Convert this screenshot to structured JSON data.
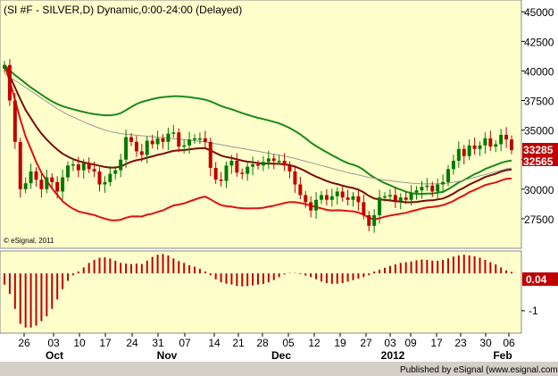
{
  "chart_data": [
    {
      "type": "candlestick",
      "title": "(SI #F - SILVER,D) Dynamic,0:00-24:00 (Delayed)",
      "watermark": "© eSignal, 2011",
      "ylim": [
        25000,
        46000
      ],
      "y_ticks": [
        "45000",
        "42500",
        "40000",
        "37500",
        "35000",
        "32500",
        "30000",
        "27500"
      ],
      "last_price_label": "33285",
      "second_price_label": "32565",
      "up_color": "#007a00",
      "down_color": "#c00000",
      "x_day_labels": [
        "26",
        "03",
        "10",
        "17",
        "24",
        "31",
        "07",
        "14",
        "21",
        "28",
        "05",
        "12",
        "19",
        "27",
        "03",
        "09",
        "17",
        "23",
        "30",
        "06"
      ],
      "x_month_labels": [
        "Oct",
        "Nov",
        "Dec",
        "2012",
        "Feb"
      ],
      "close": [
        40500,
        37500,
        34000,
        30000,
        30500,
        31500,
        30800,
        30000,
        31000,
        30600,
        29800,
        31000,
        32000,
        32100,
        31600,
        32200,
        31700,
        31500,
        30400,
        30600,
        31300,
        31600,
        32500,
        34400,
        34000,
        33200,
        32900,
        34100,
        33800,
        34300,
        34000,
        34700,
        34800,
        33600,
        33700,
        34200,
        34300,
        34300,
        34000,
        31800,
        30800,
        30700,
        32000,
        32400,
        31400,
        31300,
        31900,
        32100,
        32000,
        32300,
        32600,
        32400,
        32400,
        32000,
        31500,
        30400,
        29500,
        28900,
        28200,
        29100,
        29500,
        29100,
        29400,
        29800,
        29300,
        29100,
        29400,
        28900,
        27800,
        26900,
        27800,
        29300,
        29400,
        29500,
        29000,
        29300,
        29100,
        29700,
        29900,
        30200,
        30300,
        29800,
        30400,
        30600,
        31700,
        32400,
        33400,
        32800,
        33700,
        33400,
        33700,
        34300,
        33600,
        33800,
        34600,
        34200,
        33300
      ],
      "overlays": [
        {
          "color": "#1a8a1a",
          "values": [
            40500,
            40050,
            39650,
            39300,
            38950,
            38600,
            38300,
            38000,
            37700,
            37430,
            37200,
            37020,
            36880,
            36760,
            36640,
            36530,
            36430,
            36350,
            36290,
            36250,
            36250,
            36300,
            36430,
            36680,
            36950,
            37200,
            37380,
            37500,
            37620,
            37720,
            37780,
            37820,
            37860,
            37860,
            37830,
            37780,
            37720,
            37650,
            37570,
            37420,
            37230,
            37030,
            36880,
            36760,
            36600,
            36430,
            36290,
            36160,
            36030,
            35930,
            35820,
            35700,
            35560,
            35380,
            35170,
            34920,
            34630,
            34300,
            33940,
            33640,
            33380,
            33130,
            32880,
            32640,
            32400,
            32200,
            32070,
            31900,
            31630,
            31270,
            30980,
            30740,
            30510,
            30330,
            30120,
            29960,
            29780,
            29670,
            29600,
            29600,
            29630,
            29630,
            29700,
            29770,
            29990,
            30270,
            30560,
            30780,
            31030,
            31270,
            31460,
            31710,
            31880,
            32050,
            32230,
            32350,
            32420
          ]
        },
        {
          "color": "#7a0a0a",
          "values": [
            40500,
            39600,
            38600,
            37600,
            36700,
            36000,
            35300,
            34700,
            34200,
            33750,
            33350,
            33000,
            32750,
            32550,
            32380,
            32270,
            32170,
            32080,
            31970,
            31880,
            31820,
            31830,
            31920,
            32130,
            32320,
            32450,
            32530,
            32670,
            32770,
            32900,
            32990,
            33120,
            33240,
            33280,
            33310,
            33370,
            33420,
            33460,
            33470,
            33280,
            33050,
            32840,
            32720,
            32640,
            32520,
            32410,
            32330,
            32270,
            32210,
            32180,
            32170,
            32150,
            32140,
            32100,
            32040,
            31910,
            31730,
            31520,
            31270,
            31060,
            30880,
            30690,
            30540,
            30430,
            30300,
            30180,
            30100,
            29960,
            29730,
            29430,
            29210,
            29140,
            29090,
            29050,
            28980,
            28940,
            28890,
            28900,
            28920,
            28980,
            29040,
            29060,
            29130,
            29210,
            29400,
            29630,
            29910,
            30130,
            30390,
            30600,
            30800,
            31030,
            31170,
            31310,
            31480,
            31610,
            31660
          ]
        },
        {
          "color": "#999999",
          "values": [
            39800,
            39500,
            39200,
            38900,
            38600,
            38300,
            38000,
            37700,
            37400,
            37100,
            36800,
            36550,
            36300,
            36100,
            35900,
            35700,
            35500,
            35320,
            35150,
            35000,
            34880,
            34780,
            34700,
            34650,
            34600,
            34560,
            34520,
            34480,
            34440,
            34400,
            34360,
            34320,
            34280,
            34240,
            34200,
            34150,
            34100,
            34050,
            34000,
            33920,
            33840,
            33760,
            33680,
            33600,
            33520,
            33440,
            33360,
            33280,
            33200,
            33120,
            33040,
            32960,
            32880,
            32800,
            32700,
            32600,
            32480,
            32360,
            32240,
            32120,
            32000,
            31880,
            31760,
            31640,
            31520,
            31400,
            31300,
            31200,
            31100,
            31000,
            30920,
            30850,
            30780,
            30720,
            30660,
            30600,
            30550,
            30510,
            30480,
            30460,
            30450,
            30450,
            30460,
            30480,
            30520,
            30580,
            30660,
            30760,
            30880,
            31000,
            31120,
            31240,
            31360,
            31480,
            31600,
            31720,
            31800
          ]
        },
        {
          "color": "#e01010",
          "values": [
            40500,
            39150,
            37550,
            35900,
            34450,
            33400,
            32300,
            31400,
            30700,
            30070,
            29500,
            28980,
            28620,
            28340,
            28120,
            28010,
            27910,
            27810,
            27650,
            27510,
            27390,
            27360,
            27410,
            27580,
            27690,
            27700,
            27680,
            27840,
            27920,
            28080,
            28200,
            28420,
            28620,
            28700,
            28790,
            28960,
            29120,
            29270,
            29370,
            29140,
            28870,
            28650,
            28560,
            28520,
            28440,
            28390,
            28370,
            28380,
            28390,
            28430,
            28520,
            28600,
            28720,
            28820,
            28910,
            28900,
            28830,
            28740,
            28600,
            28480,
            28380,
            28250,
            28200,
            28220,
            28200,
            28160,
            28130,
            28020,
            27830,
            27590,
            27440,
            27540,
            27670,
            27770,
            27840,
            27920,
            28000,
            28130,
            28240,
            28360,
            28450,
            28490,
            28560,
            28650,
            28810,
            29000,
            29260,
            29480,
            29750,
            29930,
            30140,
            30350,
            30460,
            30570,
            30730,
            30870,
            30900
          ]
        }
      ]
    },
    {
      "type": "bar",
      "title": "",
      "ylim": [
        -1.6,
        0.6
      ],
      "y_ticks": [
        "-1"
      ],
      "last_value_label": "0.04",
      "pos_color": "#c00000",
      "neg_color": "#c00000",
      "values": [
        -0.3,
        -0.55,
        -0.95,
        -1.35,
        -1.45,
        -1.45,
        -1.4,
        -1.28,
        -1.15,
        -0.95,
        -0.7,
        -0.42,
        -0.2,
        -0.05,
        0.05,
        0.16,
        0.28,
        0.36,
        0.42,
        0.43,
        0.4,
        0.34,
        0.28,
        0.26,
        0.25,
        0.26,
        0.25,
        0.34,
        0.44,
        0.5,
        0.52,
        0.48,
        0.4,
        0.33,
        0.28,
        0.22,
        0.18,
        0.12,
        0.05,
        -0.05,
        -0.16,
        -0.24,
        -0.28,
        -0.3,
        -0.34,
        -0.35,
        -0.34,
        -0.32,
        -0.3,
        -0.28,
        -0.24,
        -0.18,
        -0.1,
        -0.03,
        0.01,
        0.01,
        -0.02,
        -0.06,
        -0.1,
        -0.16,
        -0.22,
        -0.26,
        -0.28,
        -0.28,
        -0.26,
        -0.22,
        -0.18,
        -0.14,
        -0.1,
        -0.05,
        0.05,
        0.1,
        0.15,
        0.2,
        0.24,
        0.28,
        0.3,
        0.32,
        0.35,
        0.37,
        0.36,
        0.34,
        0.34,
        0.36,
        0.4,
        0.45,
        0.48,
        0.5,
        0.48,
        0.46,
        0.42,
        0.36,
        0.3,
        0.24,
        0.16,
        0.08,
        0.04
      ]
    }
  ],
  "footer": "Published by eSignal (www.esignal.com)"
}
